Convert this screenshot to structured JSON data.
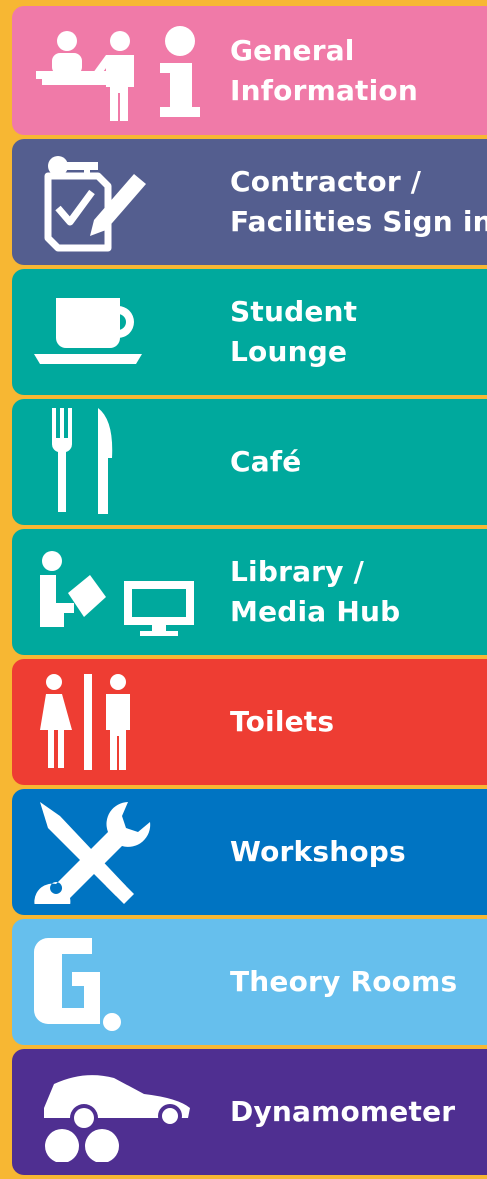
{
  "signs": [
    {
      "label": "General\nInformation",
      "color": "#f07aa8",
      "icon": "reception-info-icon"
    },
    {
      "label": "Contractor /\nFacilities Sign in",
      "color": "#545e8f",
      "icon": "clipboard-sign-in-icon"
    },
    {
      "label": "Student\nLounge",
      "color": "#00a99d",
      "icon": "coffee-cup-icon"
    },
    {
      "label": "Café",
      "color": "#00a99d",
      "icon": "fork-knife-icon"
    },
    {
      "label": "Library /\nMedia Hub",
      "color": "#00a99d",
      "icon": "reader-computer-icon"
    },
    {
      "label": "Toilets",
      "color": "#ee3d33",
      "icon": "toilets-icon"
    },
    {
      "label": "Workshops",
      "color": "#0074c2",
      "icon": "tools-icon"
    },
    {
      "label": "Theory Rooms",
      "color": "#66bfed",
      "icon": "g-rooms-icon"
    },
    {
      "label": "Dynamometer",
      "color": "#4f2f91",
      "icon": "car-dyno-icon"
    }
  ],
  "background": "#f7b733"
}
